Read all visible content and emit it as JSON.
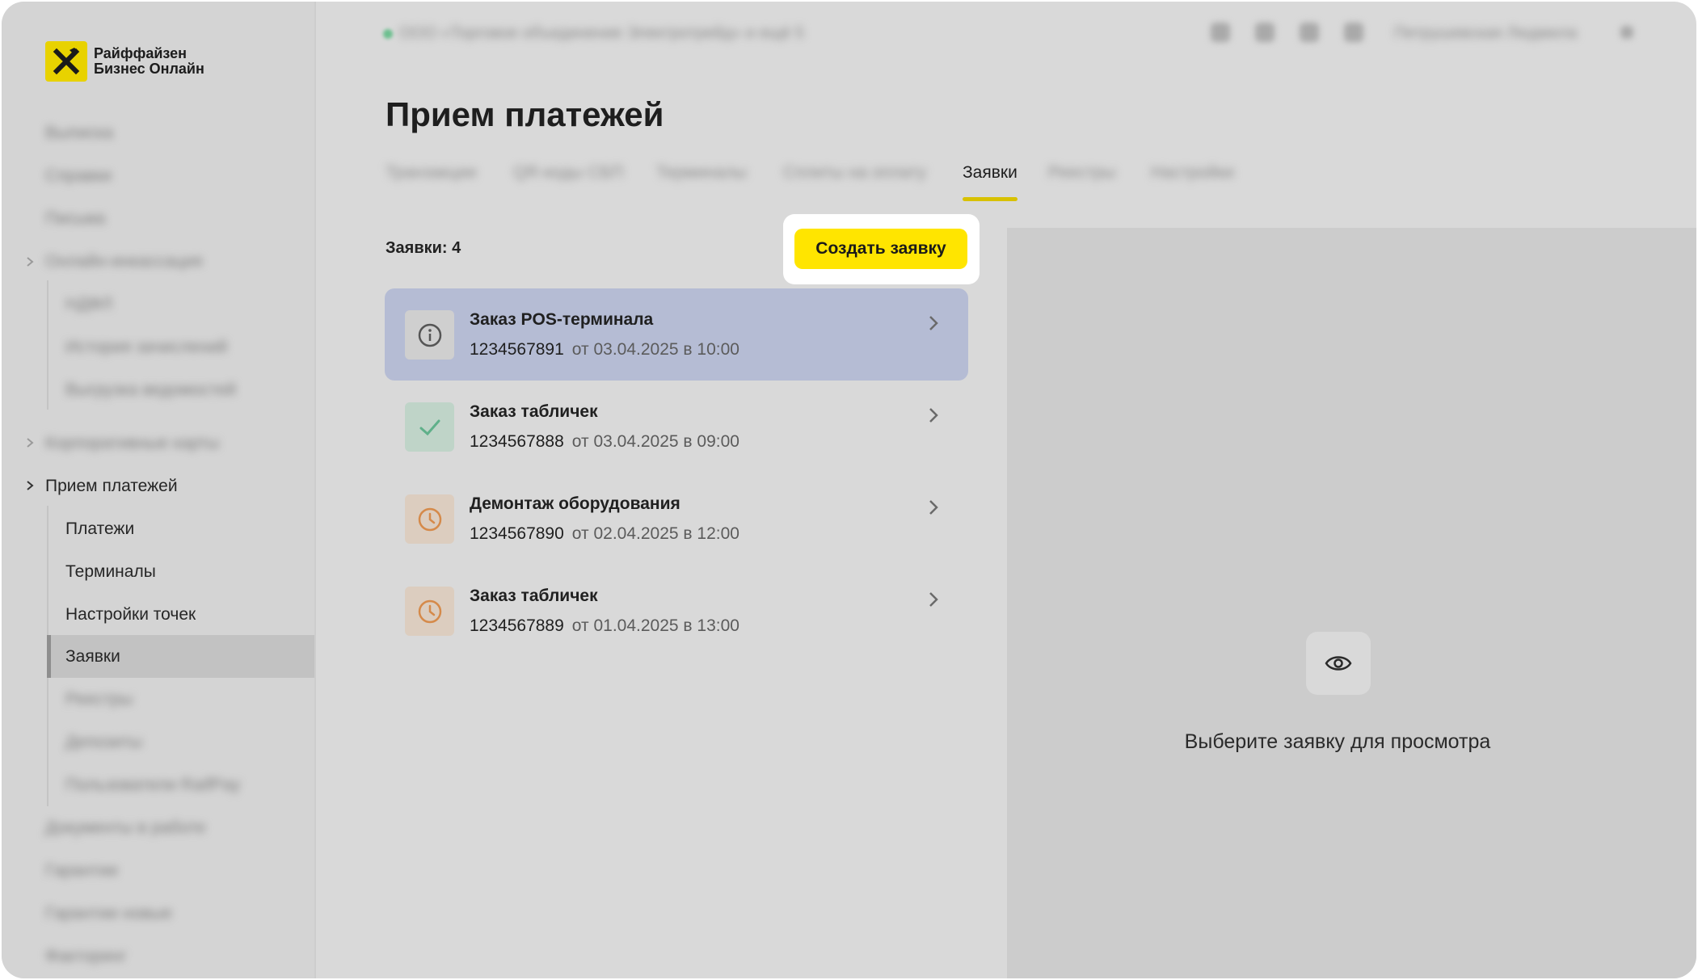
{
  "logo": {
    "line1": "Райффайзен",
    "line2": "Бизнес Онлайн"
  },
  "sidebar": {
    "items": [
      {
        "label": "Выписка",
        "blurred": true
      },
      {
        "label": "Справки",
        "blurred": true
      },
      {
        "label": "Письма",
        "blurred": true
      },
      {
        "label": "Онлайн-инкассация",
        "blurred": true
      },
      {
        "label": "НДФЛ",
        "blurred": true
      },
      {
        "label": "История зачислений",
        "blurred": true
      },
      {
        "label": "Выгрузка ведомостей",
        "blurred": true
      },
      {
        "label": "Корпоративные карты",
        "blurred": true
      },
      {
        "label": "Прием платежей",
        "blurred": false
      },
      {
        "label": "Платежи",
        "blurred": false
      },
      {
        "label": "Терминалы",
        "blurred": false
      },
      {
        "label": "Настройки точек",
        "blurred": false
      },
      {
        "label": "Заявки",
        "blurred": false,
        "active": true
      },
      {
        "label": "Реестры",
        "blurred": true
      },
      {
        "label": "Депозиты",
        "blurred": true
      },
      {
        "label": "Пользователи RaifPay",
        "blurred": true
      },
      {
        "label": "Документы в работе",
        "blurred": true
      },
      {
        "label": "Гарантии",
        "blurred": true
      },
      {
        "label": "Гарантии новые",
        "blurred": true
      },
      {
        "label": "Факторинг",
        "blurred": true
      }
    ]
  },
  "topbar": {
    "organization": "ООО «Торговое объединение Электротрейд» и ещё 5",
    "user": "Петрушевская Людмила"
  },
  "page": {
    "title": "Прием платежей"
  },
  "tabs": [
    {
      "label": "Транзакции",
      "blurred": true
    },
    {
      "label": "QR-коды СБП",
      "blurred": true
    },
    {
      "label": "Терминалы",
      "blurred": true
    },
    {
      "label": "Сплиты на оплату",
      "blurred": true
    },
    {
      "label": "Заявки",
      "active": true
    },
    {
      "label": "Реестры",
      "blurred": true
    },
    {
      "label": "Настройки",
      "blurred": true
    }
  ],
  "requests": {
    "count_label": "Заявки: 4",
    "create_button": "Создать заявку",
    "items": [
      {
        "title": "Заказ POS-терминала",
        "number": "1234567891",
        "date": "от 03.04.2025 в 10:00",
        "status_icon": "info-icon",
        "selected": true
      },
      {
        "title": "Заказ табличек",
        "number": "1234567888",
        "date": "от 03.04.2025 в 09:00",
        "status_icon": "check-icon"
      },
      {
        "title": "Демонтаж оборудования",
        "number": "1234567890",
        "date": "от 02.04.2025 в 12:00",
        "status_icon": "clock-icon"
      },
      {
        "title": "Заказ табличек",
        "number": "1234567889",
        "date": "от 01.04.2025 в 13:00",
        "status_icon": "clock-icon"
      }
    ]
  },
  "preview": {
    "empty_text": "Выберите заявку для просмотра"
  },
  "colors": {
    "accent": "#ffe500",
    "selected_row": "#b5bcd4",
    "success": "#5fb08a",
    "pending": "#d58a4a"
  }
}
